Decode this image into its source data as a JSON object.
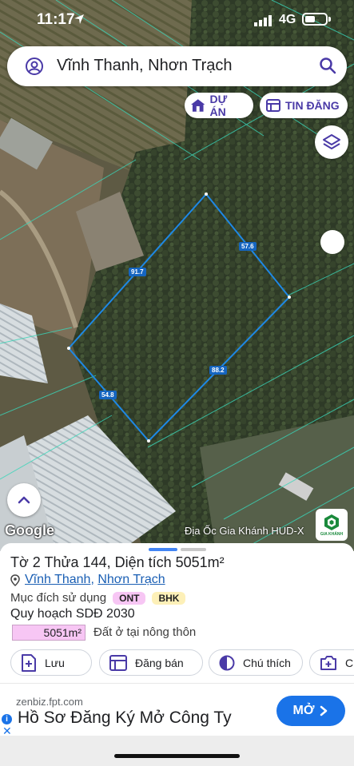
{
  "status_bar": {
    "time": "11:17",
    "network": "4G"
  },
  "search": {
    "query": "Vĩnh Thanh, Nhơn Trạch"
  },
  "chips": {
    "du_an": "DỰ ÁN",
    "tin_dang": "TIN ĐĂNG"
  },
  "map": {
    "google_logo": "Google",
    "attribution": "Địa Ốc Gia Khánh HUD-X",
    "brand_logo_text": "GIA KHÁNH",
    "edge_labels": {
      "top": "91.7",
      "right": "57.6",
      "middle": "88.2",
      "left": "54.8"
    },
    "parcel_color": "#1e88e5"
  },
  "parcel": {
    "title_prefix": "Tờ 2 Thửa 144, Diện tích ",
    "area": "5051m²",
    "location_ward": "Vĩnh Thanh",
    "location_separator": ", ",
    "location_district": "Nhơn Trạch",
    "purpose_label": "Mục đích sử dụng",
    "tags": [
      "ONT",
      "BHK"
    ],
    "plan_label": "Quy hoạch SDĐ 2030",
    "plan_area": "5051m²",
    "plan_desc": "Đất ở tại nông thôn"
  },
  "actions": {
    "save": "Lưu",
    "post": "Đăng bán",
    "note": "Chú thích",
    "capture": "Chụ"
  },
  "ad": {
    "domain": "zenbiz.fpt.com",
    "headline": "Hồ Sơ Đăng Ký Mở Công Ty",
    "cta": "MỞ"
  },
  "colors": {
    "accent": "#4a3aa7",
    "link": "#1a5fb4",
    "ad_button": "#1a73e8",
    "tag_ont": "#f7c6f4",
    "tag_bhk": "#fdf0b8"
  }
}
